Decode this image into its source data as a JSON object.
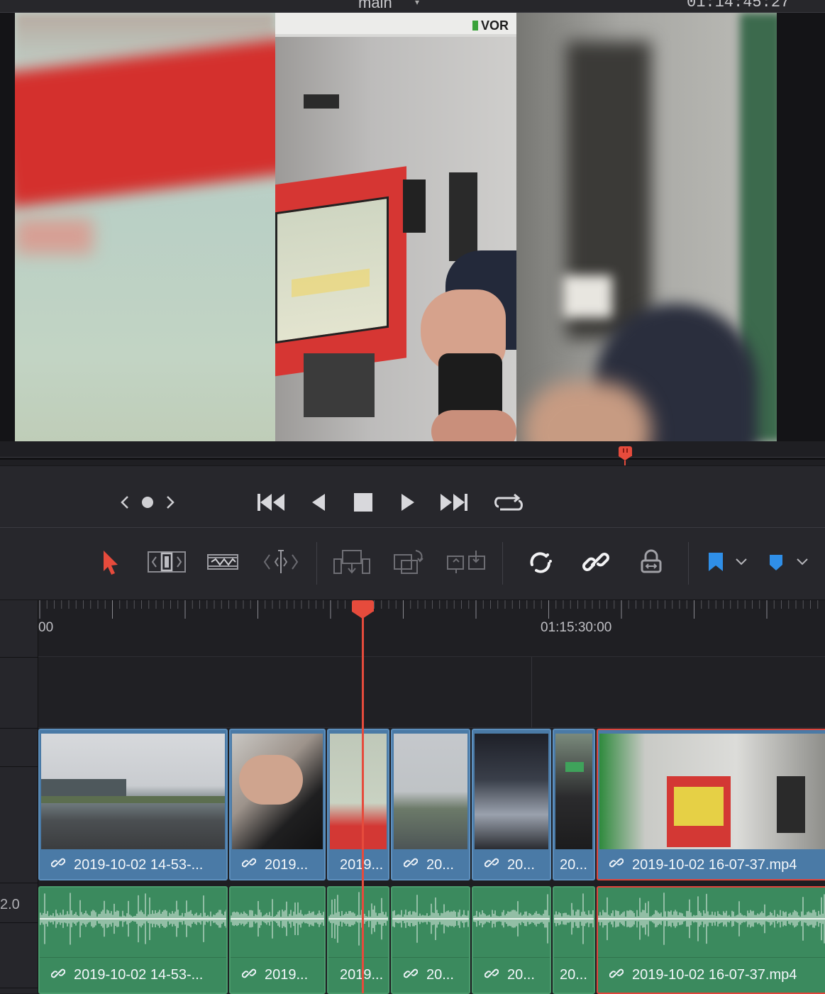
{
  "viewer": {
    "title": "main",
    "timecode": "01:14:45:27"
  },
  "transport": {
    "buttons": [
      "prev-clip",
      "mark",
      "next-clip",
      "go-to-start",
      "play-reverse",
      "stop",
      "play",
      "go-to-end",
      "loop"
    ]
  },
  "toolbar": {
    "tools": [
      "selection-mode",
      "trim-edit-mode",
      "dynamic-trim-mode",
      "blade-edit-mode",
      "insert-clip",
      "overwrite-clip",
      "replace-clip",
      "snapping",
      "linked-selection",
      "position-lock",
      "flag",
      "marker"
    ],
    "accent": "#e64b3c",
    "flag_color": "#2f8fe8",
    "marker_color": "#2f8fe8"
  },
  "ruler": {
    "labels": [
      {
        "text": "00"
      },
      {
        "text": "01:15:30:00"
      }
    ]
  },
  "tracks": {
    "audio_level": "2.0",
    "video_clips": [
      {
        "label": "2019-10-02 14-53-...",
        "selected": false
      },
      {
        "label": "2019...",
        "selected": false
      },
      {
        "label": "2019...",
        "selected": false
      },
      {
        "label": "20...",
        "selected": false
      },
      {
        "label": "20...",
        "selected": false
      },
      {
        "label": "20...",
        "selected": false
      },
      {
        "label": "2019-10-02 16-07-37.mp4",
        "selected": true
      }
    ],
    "audio_clips": [
      {
        "label": "2019-10-02 14-53-...",
        "selected": false
      },
      {
        "label": "2019...",
        "selected": false
      },
      {
        "label": "2019...",
        "selected": false
      },
      {
        "label": "20...",
        "selected": false
      },
      {
        "label": "20...",
        "selected": false
      },
      {
        "label": "20...",
        "selected": false
      },
      {
        "label": "2019-10-02 16-07-37.mp4",
        "selected": true
      }
    ]
  },
  "colors": {
    "video_clip": "#4a7aa6",
    "audio_clip": "#3b8a5e",
    "playhead": "#e64b3c",
    "selected_border": "#e0453b"
  }
}
